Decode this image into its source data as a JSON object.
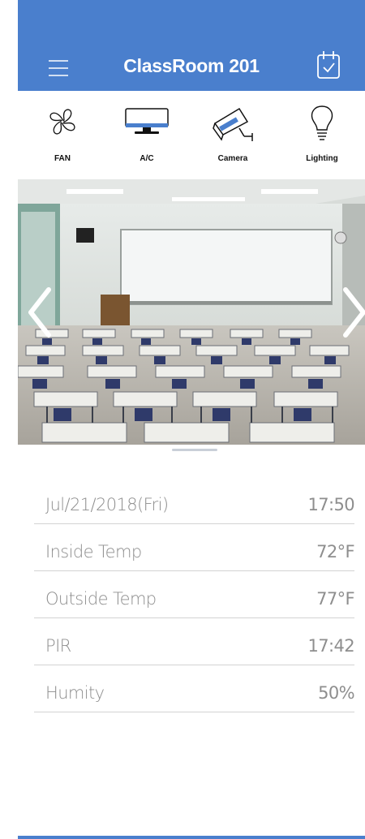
{
  "header": {
    "title": "ClassRoom 201",
    "menu_icon": "menu-icon",
    "calendar_icon": "calendar-check-icon"
  },
  "toolbar": {
    "items": [
      {
        "label": "FAN",
        "icon": "fan-icon"
      },
      {
        "label": "A/C",
        "icon": "ac-unit-icon"
      },
      {
        "label": "Camera",
        "icon": "security-camera-icon"
      },
      {
        "label": "Lighting",
        "icon": "light-bulb-icon"
      }
    ]
  },
  "carousel": {
    "image": "classroom-photo",
    "prev_icon": "chevron-left-icon",
    "next_icon": "chevron-right-icon"
  },
  "info": {
    "rows": [
      {
        "label": "Jul/21/2018(Fri)",
        "value": "17:50"
      },
      {
        "label": "Inside Temp",
        "value": "72°F"
      },
      {
        "label": "Outside Temp",
        "value": "77°F"
      },
      {
        "label": "PIR",
        "value": "17:42"
      },
      {
        "label": "Humity",
        "value": "50%"
      }
    ]
  },
  "colors": {
    "accent": "#4a7fcd",
    "text_muted": "#8e8e8e",
    "divider": "#d3d3d3"
  }
}
